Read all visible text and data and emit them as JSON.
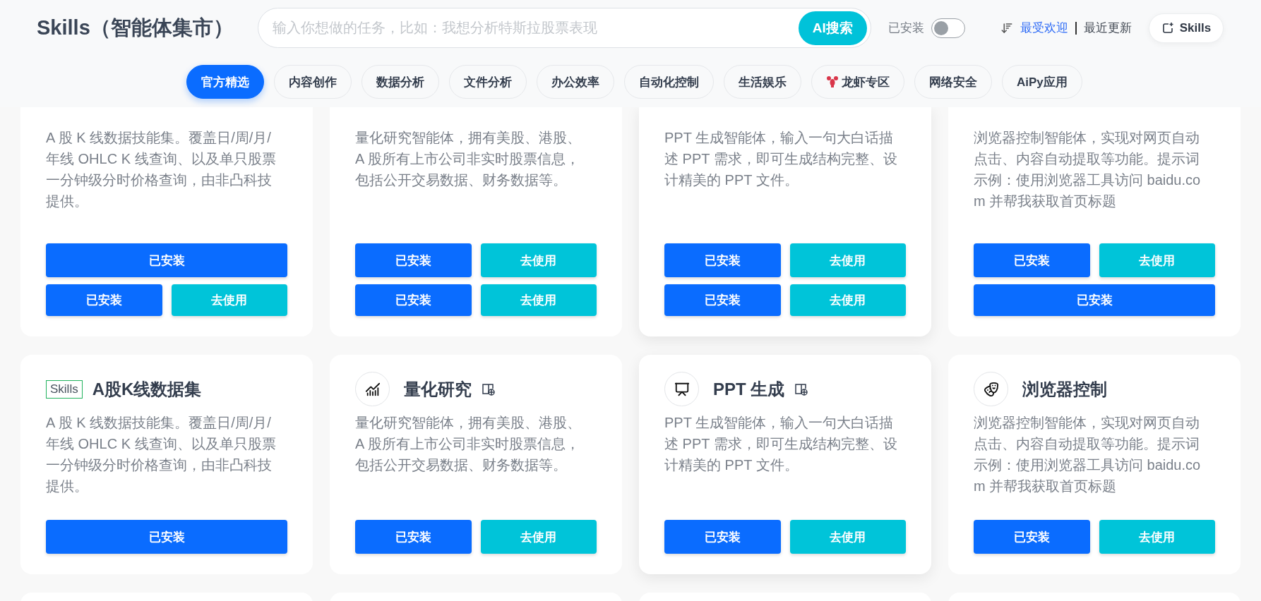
{
  "header": {
    "title": "Skills（智能体集市）",
    "search": {
      "placeholder": "输入你想做的任务，比如：我想分析特斯拉股票表现",
      "button": "AI搜索"
    },
    "installed_filter": {
      "label": "已安装",
      "on": false
    },
    "sort": [
      {
        "label": "最受欢迎",
        "selected": true
      },
      {
        "label": "最近更新",
        "selected": false
      }
    ],
    "skills_button": "Skills"
  },
  "tabs": [
    {
      "label": "官方精选",
      "selected": true,
      "kind": "plain"
    },
    {
      "label": "内容创作",
      "selected": false,
      "kind": "plain"
    },
    {
      "label": "数据分析",
      "selected": false,
      "kind": "plain"
    },
    {
      "label": "文件分析",
      "selected": false,
      "kind": "plain"
    },
    {
      "label": "办公效率",
      "selected": false,
      "kind": "plain"
    },
    {
      "label": "自动化控制",
      "selected": false,
      "kind": "plain"
    },
    {
      "label": "生活娱乐",
      "selected": false,
      "kind": "plain"
    },
    {
      "label": "龙虾专区",
      "selected": false,
      "kind": "lobster"
    },
    {
      "label": "网络安全",
      "selected": false,
      "kind": "plain"
    },
    {
      "label": "AiPy应用",
      "selected": false,
      "kind": "plain"
    }
  ],
  "cards": [
    {
      "kind": "cut",
      "raised": false,
      "description": "A 股 K 线数据技能集。覆盖日/周/月/年线 OHLC K 线查询、以及单只股票一分钟级分时价格查询，由非凸科技提供。",
      "button_rows": [
        [
          {
            "label": "已安装",
            "kind": "installed"
          }
        ],
        [
          {
            "label": "已安装",
            "kind": "installed"
          },
          {
            "label": "去使用",
            "kind": "use"
          }
        ]
      ]
    },
    {
      "kind": "cut",
      "raised": false,
      "description": "量化研究智能体，拥有美股、港股、A 股所有上市公司非实时股票信息，包括公开交易数据、财务数据等。",
      "button_rows": [
        [
          {
            "label": "已安装",
            "kind": "installed"
          },
          {
            "label": "去使用",
            "kind": "use"
          }
        ],
        [
          {
            "label": "已安装",
            "kind": "installed"
          },
          {
            "label": "去使用",
            "kind": "use"
          }
        ]
      ]
    },
    {
      "kind": "cut",
      "raised": true,
      "description": "PPT 生成智能体，输入一句大白话描述 PPT 需求，即可生成结构完整、设计精美的 PPT 文件。",
      "button_rows": [
        [
          {
            "label": "已安装",
            "kind": "installed"
          },
          {
            "label": "去使用",
            "kind": "use"
          }
        ],
        [
          {
            "label": "已安装",
            "kind": "installed"
          },
          {
            "label": "去使用",
            "kind": "use"
          }
        ]
      ]
    },
    {
      "kind": "cut",
      "raised": false,
      "description": "浏览器控制智能体，实现对网页自动点击、内容自动提取等功能。提示词示例：使用浏览器工具访问 baidu.com 并帮我获取首页标题",
      "button_rows": [
        [
          {
            "label": "已安装",
            "kind": "installed"
          },
          {
            "label": "去使用",
            "kind": "use"
          }
        ],
        [
          {
            "label": "已安装",
            "kind": "installed"
          }
        ]
      ]
    },
    {
      "kind": "full",
      "tag": "Skills",
      "title": "A股K线数据集",
      "raised": false,
      "description": "A 股 K 线数据技能集。覆盖日/周/月/年线 OHLC K 线查询、以及单只股票一分钟级分时价格查询，由非凸科技提供。",
      "button_rows": [
        [
          {
            "label": "已安装",
            "kind": "installed"
          }
        ]
      ]
    },
    {
      "kind": "full",
      "title": "量化研究",
      "raised": false,
      "description": "量化研究智能体，拥有美股、港股、A 股所有上市公司非实时股票信息，包括公开交易数据、财务数据等。",
      "button_rows": [
        [
          {
            "label": "已安装",
            "kind": "installed"
          },
          {
            "label": "去使用",
            "kind": "use"
          }
        ]
      ]
    },
    {
      "kind": "full",
      "title": "PPT 生成",
      "raised": true,
      "description": "PPT 生成智能体，输入一句大白话描述 PPT 需求，即可生成结构完整、设计精美的 PPT 文件。",
      "button_rows": [
        [
          {
            "label": "已安装",
            "kind": "installed"
          },
          {
            "label": "去使用",
            "kind": "use"
          }
        ]
      ]
    },
    {
      "kind": "full",
      "title": "浏览器控制",
      "raised": false,
      "description": "浏览器控制智能体，实现对网页自动点击、内容自动提取等功能。提示词示例：使用浏览器工具访问 baidu.com 并帮我获取首页标题",
      "button_rows": [
        [
          {
            "label": "已安装",
            "kind": "installed"
          },
          {
            "label": "去使用",
            "kind": "use"
          }
        ]
      ]
    },
    {
      "kind": "stub"
    },
    {
      "kind": "stub"
    },
    {
      "kind": "stub"
    },
    {
      "kind": "stub"
    }
  ]
}
